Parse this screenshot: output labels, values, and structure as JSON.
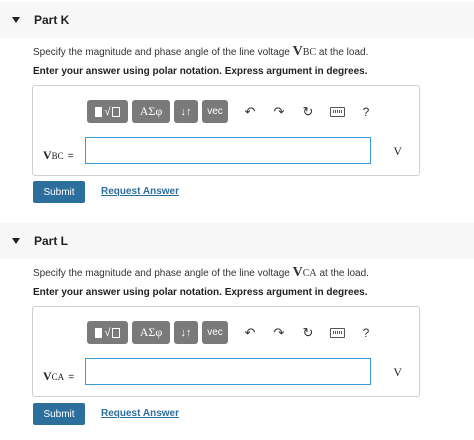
{
  "parts": [
    {
      "title": "Part K",
      "prompt_prefix": "Specify the magnitude and phase angle of the line voltage ",
      "var_main": "V",
      "var_sub": "BC",
      "prompt_suffix": " at the load.",
      "instruction": "Enter your answer using polar notation. Express argument in degrees.",
      "toolbar": {
        "template": "√",
        "greek": "ΑΣφ",
        "arrows": "↓↑",
        "vec": "vec",
        "undo": "↶",
        "redo": "↷",
        "reset": "↻",
        "help": "?"
      },
      "field_label_main": "V",
      "field_label_sub": "BC",
      "field_eq": "=",
      "input_value": "",
      "unit": "V",
      "submit": "Submit",
      "request": "Request Answer"
    },
    {
      "title": "Part L",
      "prompt_prefix": "Specify the magnitude and phase angle of the line voltage ",
      "var_main": "V",
      "var_sub": "CA",
      "prompt_suffix": " at the load.",
      "instruction": "Enter your answer using polar notation. Express argument in degrees.",
      "toolbar": {
        "template": "√",
        "greek": "ΑΣφ",
        "arrows": "↓↑",
        "vec": "vec",
        "undo": "↶",
        "redo": "↷",
        "reset": "↻",
        "help": "?"
      },
      "field_label_main": "V",
      "field_label_sub": "CA",
      "field_eq": "=",
      "input_value": "",
      "unit": "V",
      "submit": "Submit",
      "request": "Request Answer"
    }
  ],
  "colors": {
    "header_bg": "#f7f7f7",
    "toolbar_btn": "#7a7a7a",
    "input_border": "#3a9bd8",
    "submit_bg": "#2d6f9c",
    "link": "#2d6f9c"
  }
}
